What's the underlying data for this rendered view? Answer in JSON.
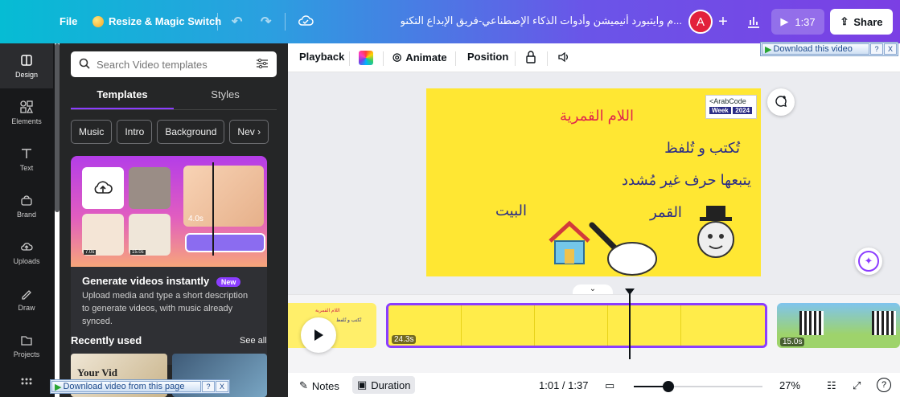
{
  "header": {
    "file_label": "File",
    "resize_label": "Resize & Magic Switch",
    "doc_title": "...م وايتبورد أنيميشن وأدوات الذكاء الإصطناعي-فريق الإبداع التكنولوجي",
    "avatar_initial": "A",
    "play_time": "1:37",
    "share_label": "Share"
  },
  "rail": {
    "items": [
      {
        "label": "Design",
        "icon": "design-icon"
      },
      {
        "label": "Elements",
        "icon": "elements-icon"
      },
      {
        "label": "Text",
        "icon": "text-icon"
      },
      {
        "label": "Brand",
        "icon": "brand-icon"
      },
      {
        "label": "Uploads",
        "icon": "uploads-icon"
      },
      {
        "label": "Draw",
        "icon": "draw-icon"
      },
      {
        "label": "Projects",
        "icon": "projects-icon"
      }
    ]
  },
  "panel": {
    "search_placeholder": "Search Video templates",
    "tabs": [
      "Templates",
      "Styles"
    ],
    "chips": [
      "Music",
      "Intro",
      "Background",
      "Nev"
    ],
    "promo": {
      "tag_time": "4.0s",
      "thumb_times": [
        "7.0s",
        "15.0s"
      ],
      "title": "Generate videos instantly",
      "badge": "New",
      "description": "Upload media and type a short description to generate videos, with music already synced."
    },
    "recent_heading": "Recently used",
    "see_all": "See all",
    "thumb1_text": "Your Vid"
  },
  "toolbar": {
    "playback": "Playback",
    "animate": "Animate",
    "position": "Position",
    "download_this_video": "Download this video",
    "help": "?",
    "close": "X"
  },
  "slide": {
    "title": "اللام القمرية",
    "line1": "تُكتب و تُلفظ",
    "line2": "يتبعها حرف غير مُشدد",
    "word_left": "البيت",
    "word_right": "القمر",
    "logo_top": "<ArabCode",
    "logo_bottom": "Week",
    "logo_year": "2024"
  },
  "timeline": {
    "clip1_title": "اللام القمرية",
    "clip1_sub": "تُكتب و تُلفظ",
    "clip2_duration": "24.3s",
    "clip3_duration": "15.0s"
  },
  "bottom": {
    "notes": "Notes",
    "duration": "Duration",
    "time": "1:01 / 1:37",
    "zoom_value": 0.27,
    "zoom_label": "27%",
    "help": "?"
  },
  "download_bar": {
    "label": "Download video from this page",
    "help": "?",
    "close": "X"
  },
  "colors": {
    "accent": "#8b3dff",
    "slide_bg": "#ffe733",
    "avatar": "#e2213b"
  }
}
